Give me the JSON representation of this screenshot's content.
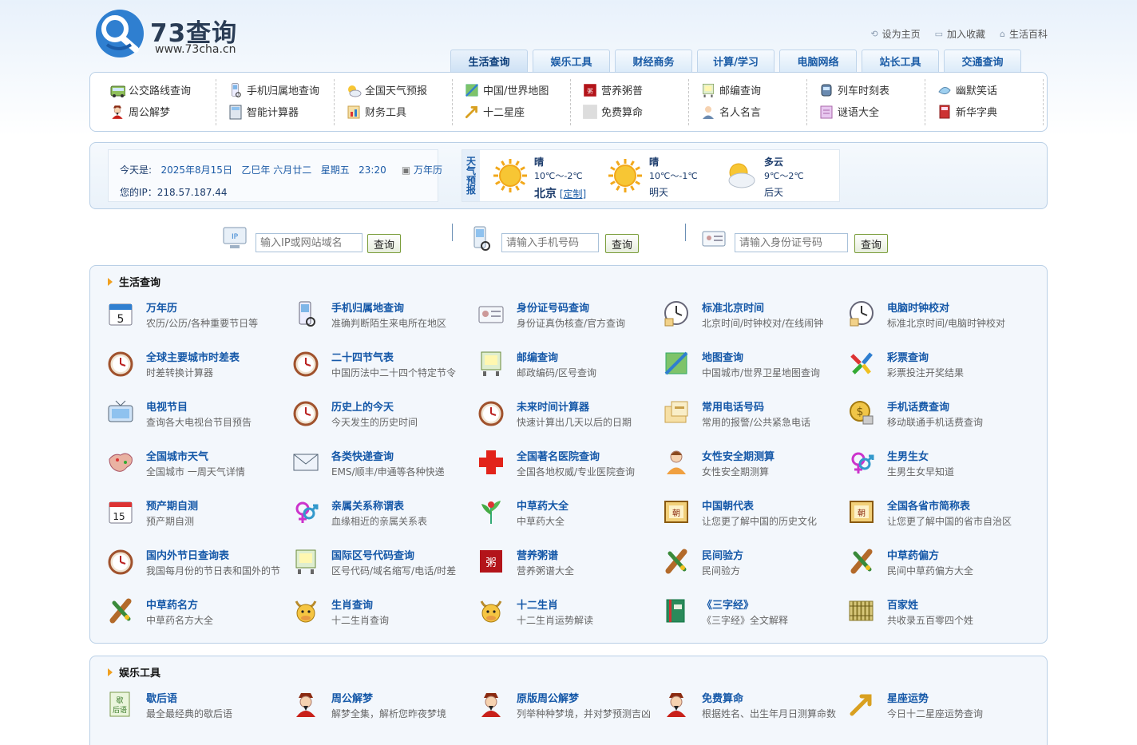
{
  "site": {
    "name": "73查询",
    "url": "www.73cha.cn",
    "top_links": [
      {
        "label": "设为主页",
        "icon": "home-set-icon"
      },
      {
        "label": "加入收藏",
        "icon": "bookmark-icon"
      },
      {
        "label": "生活百科",
        "icon": "house-icon"
      }
    ]
  },
  "nav": {
    "tabs": [
      "生活查询",
      "娱乐工具",
      "财经商务",
      "计算/学习",
      "电脑网络",
      "站长工具",
      "交通查询"
    ],
    "active": "生活查询"
  },
  "quick_links": [
    [
      {
        "label": "公交路线查询",
        "icon": "bus-icon"
      },
      {
        "label": "周公解梦",
        "icon": "zhougong-icon"
      }
    ],
    [
      {
        "label": "手机归属地查询",
        "icon": "mobile-icon"
      },
      {
        "label": "智能计算器",
        "icon": "calculator-icon"
      }
    ],
    [
      {
        "label": "全国天气预报",
        "icon": "weather-icon"
      },
      {
        "label": "财务工具",
        "icon": "finance-icon"
      }
    ],
    [
      {
        "label": "中国/世界地图",
        "icon": "map-icon"
      },
      {
        "label": "十二星座",
        "icon": "zodiac-icon"
      }
    ],
    [
      {
        "label": "营养粥普",
        "icon": "porridge-icon"
      },
      {
        "label": "免费算命",
        "icon": "fortune-icon"
      }
    ],
    [
      {
        "label": "邮编查询",
        "icon": "postcode-icon"
      },
      {
        "label": "名人名言",
        "icon": "quote-icon"
      }
    ],
    [
      {
        "label": "列车时刻表",
        "icon": "train-icon"
      },
      {
        "label": "谜语大全",
        "icon": "riddle-icon"
      }
    ],
    [
      {
        "label": "幽默笑话",
        "icon": "joke-icon"
      },
      {
        "label": "新华字典",
        "icon": "dictionary-icon"
      }
    ]
  ],
  "info": {
    "today_label": "今天是:",
    "date": "2025年8月15日",
    "lunar": "乙巳年 六月廿二",
    "weekday": "星期五",
    "time": "23:20",
    "calendar_link": "万年历",
    "ip_line": "您的IP：218.57.187.44",
    "weather_label": "天气预报",
    "weather": [
      {
        "cond": "晴",
        "temp": "10℃～-2℃",
        "city": "北京",
        "custom": "[定制]",
        "day": "",
        "icon": "sun-icon"
      },
      {
        "cond": "晴",
        "temp": "10℃～-1℃",
        "city": "",
        "custom": "",
        "day": "明天",
        "icon": "sun-icon"
      },
      {
        "cond": "多云",
        "temp": "9℃～2℃",
        "city": "",
        "custom": "",
        "day": "后天",
        "icon": "cloudy-icon"
      }
    ]
  },
  "search": {
    "ip": {
      "placeholder": "输入IP或网站域名",
      "button": "查询"
    },
    "phone": {
      "placeholder": "请输入手机号码",
      "button": "查询"
    },
    "idcard": {
      "placeholder": "请输入身份证号码",
      "button": "查询"
    },
    "ip_icon_text": "IP"
  },
  "sections": [
    {
      "title": "生活查询",
      "items": [
        {
          "title": "万年历",
          "desc": "农历/公历/各种重要节日等",
          "icon": "calendar-icon"
        },
        {
          "title": "手机归属地查询",
          "desc": "准确判断陌生来电所在地区",
          "icon": "mobile-icon"
        },
        {
          "title": "身份证号码查询",
          "desc": "身份证真伪核查/官方查询",
          "icon": "idcard-icon"
        },
        {
          "title": "标准北京时间",
          "desc": "北京时间/时钟校对/在线闹钟",
          "icon": "clock-icon"
        },
        {
          "title": "电脑时钟校对",
          "desc": "标准北京时间/电脑时钟校对",
          "icon": "clock-icon"
        },
        {
          "title": "全球主要城市时差表",
          "desc": "时差转换计算器",
          "icon": "timer-icon"
        },
        {
          "title": "二十四节气表",
          "desc": "中国历法中二十四个特定节令",
          "icon": "timer-icon"
        },
        {
          "title": "邮编查询",
          "desc": "邮政编码/区号查询",
          "icon": "postcode-icon"
        },
        {
          "title": "地图查询",
          "desc": "中国城市/世界卫星地图查询",
          "icon": "map-icon"
        },
        {
          "title": "彩票查询",
          "desc": "彩票投注开奖结果",
          "icon": "lottery-icon"
        },
        {
          "title": "电视节目",
          "desc": "查询各大电视台节目预告",
          "icon": "tv-icon"
        },
        {
          "title": "历史上的今天",
          "desc": "今天发生的历史时间",
          "icon": "timer-icon"
        },
        {
          "title": "未来时间计算器",
          "desc": "快速计算出几天以后的日期",
          "icon": "timer-icon"
        },
        {
          "title": "常用电话号码",
          "desc": "常用的报警/公共紧急电话",
          "icon": "phonebook-icon"
        },
        {
          "title": "手机话费查询",
          "desc": "移动联通手机话费查询",
          "icon": "coin-icon"
        },
        {
          "title": "全国城市天气",
          "desc": "全国城市 一周天气详情",
          "icon": "china-map-icon"
        },
        {
          "title": "各类快递查询",
          "desc": "EMS/顺丰/申通等各种快递",
          "icon": "envelope-icon"
        },
        {
          "title": "全国著名医院查询",
          "desc": "全国各地权威/专业医院查询",
          "icon": "hospital-cross-icon"
        },
        {
          "title": "女性安全期测算",
          "desc": "女性安全期测算",
          "icon": "woman-icon"
        },
        {
          "title": "生男生女",
          "desc": "生男生女早知道",
          "icon": "gender-icon"
        },
        {
          "title": "预产期自测",
          "desc": "预产期自测",
          "icon": "calendar-15-icon"
        },
        {
          "title": "亲属关系称谓表",
          "desc": "血缘相近的亲属关系表",
          "icon": "gender-icon"
        },
        {
          "title": "中草药大全",
          "desc": "中草药大全",
          "icon": "herb-icon"
        },
        {
          "title": "中国朝代表",
          "desc": "让您更了解中国的历史文化",
          "icon": "scroll-icon"
        },
        {
          "title": "全国各省市简称表",
          "desc": "让您更了解中国的省市自治区",
          "icon": "scroll-icon"
        },
        {
          "title": "国内外节日查询表",
          "desc": "我国每月份的节日表和国外的节",
          "icon": "timer-icon"
        },
        {
          "title": "国际区号代码查询",
          "desc": "区号代码/域名缩写/电话/时差",
          "icon": "postcode-icon"
        },
        {
          "title": "营养粥谱",
          "desc": "营养粥谱大全",
          "icon": "porridge-icon"
        },
        {
          "title": "民间验方",
          "desc": "民间验方",
          "icon": "medicine-icon"
        },
        {
          "title": "中草药偏方",
          "desc": "民间中草药偏方大全",
          "icon": "medicine-icon"
        },
        {
          "title": "中草药名方",
          "desc": "中草药名方大全",
          "icon": "medicine-icon"
        },
        {
          "title": "生肖查询",
          "desc": "十二生肖查询",
          "icon": "ox-icon"
        },
        {
          "title": "十二生肖",
          "desc": "十二生肖运势解读",
          "icon": "ox-icon"
        },
        {
          "title": "《三字经》",
          "desc": "《三字经》全文解释",
          "icon": "book-icon"
        },
        {
          "title": "百家姓",
          "desc": "共收录五百零四个姓",
          "icon": "bamboo-slips-icon"
        }
      ]
    },
    {
      "title": "娱乐工具",
      "items": [
        {
          "title": "歇后语",
          "desc": "最全最经典的歇后语",
          "icon": "xiehouyu-icon"
        },
        {
          "title": "周公解梦",
          "desc": "解梦全集，解析您昨夜梦境",
          "icon": "zhougong-icon"
        },
        {
          "title": "原版周公解梦",
          "desc": "列举种种梦境，并对梦预测吉凶",
          "icon": "zhougong-icon"
        },
        {
          "title": "免费算命",
          "desc": "根据姓名、出生年月日测算命数",
          "icon": "zhougong-icon"
        },
        {
          "title": "星座运势",
          "desc": "今日十二星座运势查询",
          "icon": "zodiac-icon"
        }
      ]
    }
  ],
  "colors": {
    "link_blue": "#1558a8",
    "accent_orange": "#f0a020",
    "panel_border": "#b9cfe6"
  }
}
